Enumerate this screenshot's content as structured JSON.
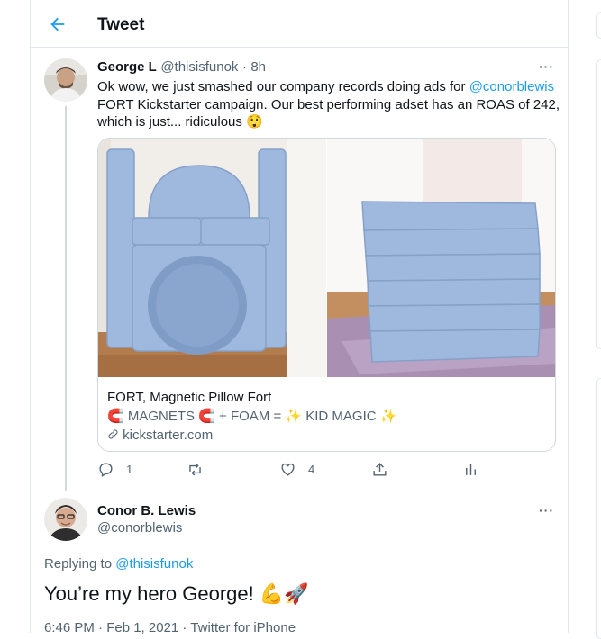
{
  "header": {
    "title": "Tweet"
  },
  "tweet": {
    "author_name": "George L",
    "author_handle": "@thisisfunok",
    "separator": "·",
    "time": "8h",
    "text_part1": "Ok wow, we just smashed our company records doing ads for",
    "text_mention": "@conorblewis",
    "text_part2": "FORT Kickstarter campaign. Our best performing adset has an ROAS of 242, which is just... ridiculous",
    "text_emoji": "😲",
    "more": "···",
    "card": {
      "title": "FORT, Magnetic Pillow Fort",
      "description": "🧲 MAGNETS 🧲 + FOAM = ✨ KID MAGIC ✨",
      "domain": "kickstarter.com"
    },
    "actions": {
      "reply_count": "1",
      "retweet_count": "",
      "like_count": "4"
    }
  },
  "reply": {
    "author_name": "Conor B. Lewis",
    "author_handle": "@conorblewis",
    "more": "···",
    "replying_prefix": "Replying to",
    "replying_handle": "@thisisfunok",
    "text": "You’re my hero George! 💪🚀",
    "meta": "6:46 PM · Feb 1, 2021 · Twitter for iPhone"
  },
  "colors": {
    "accent": "#1d9bf0",
    "muted": "#536471",
    "border": "#e1e8ed",
    "pillow": "#9fb8de"
  }
}
